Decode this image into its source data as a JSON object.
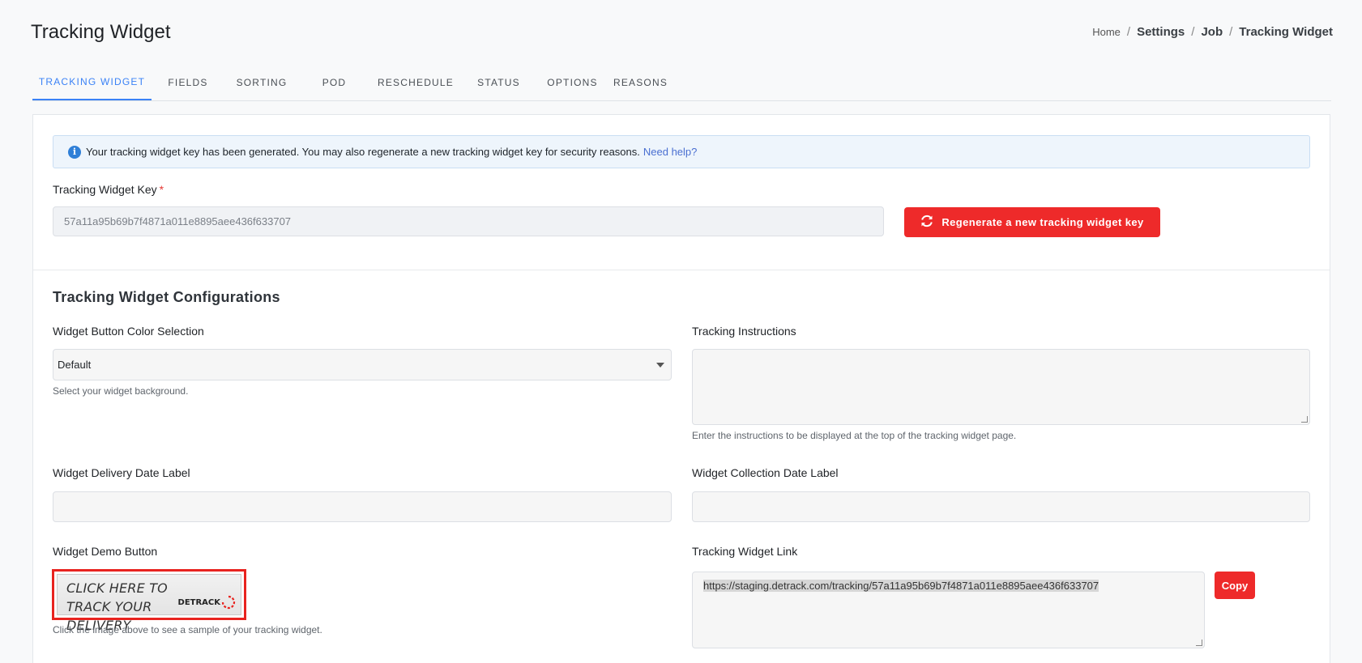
{
  "page": {
    "title": "Tracking Widget"
  },
  "breadcrumb": {
    "home": "Home",
    "settings": "Settings",
    "job": "Job",
    "current": "Tracking Widget",
    "separator": "/"
  },
  "tabs": [
    {
      "label": "TRACKING WIDGET",
      "active": true
    },
    {
      "label": "FIELDS"
    },
    {
      "label": "SORTING"
    },
    {
      "label": "POD"
    },
    {
      "label": "RESCHEDULE"
    },
    {
      "label": "STATUS"
    },
    {
      "label": "OPTIONS"
    },
    {
      "label": "REASONS"
    }
  ],
  "alert": {
    "icon": "info-icon",
    "message": "Your tracking widget key has been generated. You may also regenerate a new tracking widget key for security reasons.",
    "help_link": "Need help?"
  },
  "key_section": {
    "label": "Tracking Widget Key",
    "required_mark": "*",
    "value": "57a11a95b69b7f4871a011e8895aee436f633707",
    "regenerate_button": "Regenerate a new tracking widget key",
    "regenerate_icon": "refresh-icon"
  },
  "config": {
    "title": "Tracking Widget Configurations",
    "button_color": {
      "label": "Widget Button Color Selection",
      "selected": "Default",
      "helper": "Select your widget background."
    },
    "tracking_instructions": {
      "label": "Tracking Instructions",
      "value": "",
      "helper": "Enter the instructions to be displayed at the top of the tracking widget page."
    },
    "delivery_date_label": {
      "label": "Widget Delivery Date Label",
      "value": ""
    },
    "collection_date_label": {
      "label": "Widget Collection Date Label",
      "value": ""
    },
    "demo_button": {
      "label": "Widget Demo Button",
      "text": "CLICK HERE TO TRACK YOUR DELIVERY",
      "logo_text": "DETRACK",
      "helper": "Click the image above to see a sample of your tracking widget."
    },
    "tracking_link": {
      "label": "Tracking Widget Link",
      "value": "https://staging.detrack.com/tracking/57a11a95b69b7f4871a011e8895aee436f633707",
      "copy_button": "Copy"
    }
  },
  "colors": {
    "accent_blue": "#3b82f6",
    "danger_red": "#ee2a2a",
    "alert_bg": "#eef5fc"
  }
}
